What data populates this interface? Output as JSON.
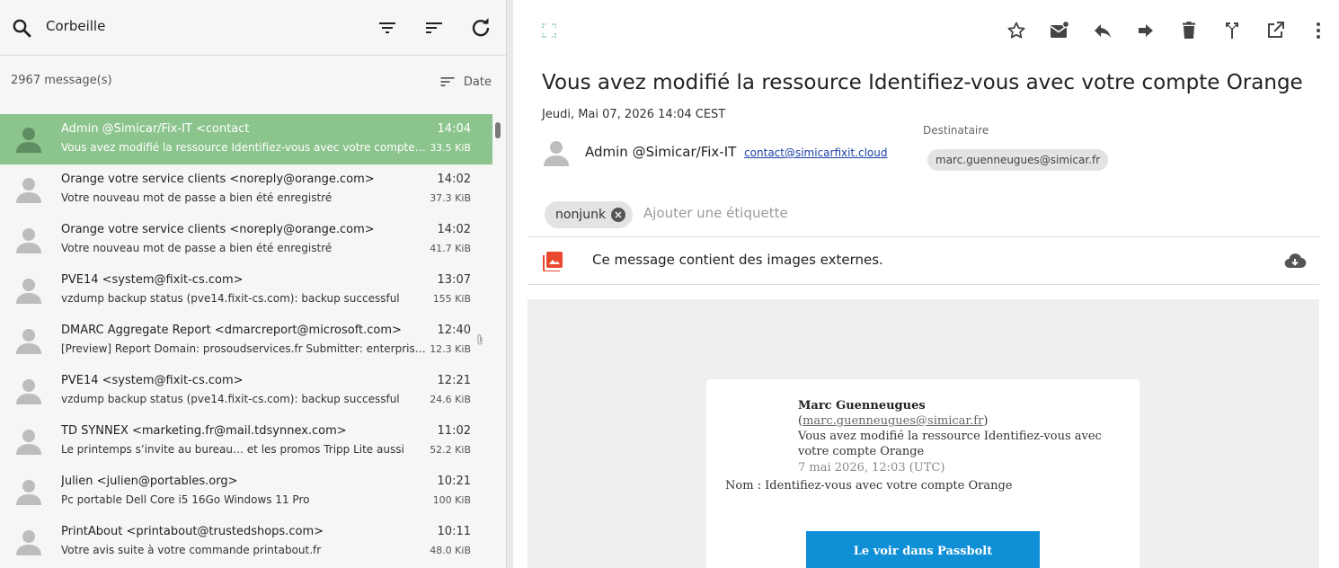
{
  "search": {
    "folder": "Corbeille"
  },
  "list_header": {
    "count": "2967 message(s)",
    "sort_label": "Date"
  },
  "messages": [
    {
      "sender": "Admin @Simicar/Fix-IT <contact",
      "subject": "Vous avez modifié la ressource Identifiez-vous avec votre compte Orange",
      "time": "14:04",
      "size": "33.5 KiB",
      "selected": true
    },
    {
      "sender": "Orange votre service clients <noreply@orange.com>",
      "subject": "Votre nouveau mot de passe a bien été enregistré",
      "time": "14:02",
      "size": "37.3 KiB"
    },
    {
      "sender": "Orange votre service clients <noreply@orange.com>",
      "subject": "Votre nouveau mot de passe a bien été enregistré",
      "time": "14:02",
      "size": "41.7 KiB"
    },
    {
      "sender": "PVE14 <system@fixit-cs.com>",
      "subject": "vzdump backup status (pve14.fixit-cs.com): backup successful",
      "time": "13:07",
      "size": "155 KiB"
    },
    {
      "sender": "DMARC Aggregate Report <dmarcreport@microsoft.com>",
      "subject": "[Preview] Report Domain: prosoudservices.fr Submitter: enterprise.protection.outlook.com",
      "time": "12:40",
      "size": "12.3 KiB",
      "attachment": true
    },
    {
      "sender": "PVE14 <system@fixit-cs.com>",
      "subject": "vzdump backup status (pve14.fixit-cs.com): backup successful",
      "time": "12:21",
      "size": "24.6 KiB"
    },
    {
      "sender": "TD SYNNEX <marketing.fr@mail.tdsynnex.com>",
      "subject": "Le printemps s’invite au bureau… et les promos Tripp Lite aussi",
      "time": "11:02",
      "size": "52.2 KiB"
    },
    {
      "sender": "Julien <julien@portables.org>",
      "subject": "Pc portable Dell Core i5 16Go Windows 11 Pro",
      "time": "10:21",
      "size": "100 KiB"
    },
    {
      "sender": "PrintAbout <printabout@trustedshops.com>",
      "subject": "Votre avis suite à votre commande printabout.fr",
      "time": "10:11",
      "size": "48.0 KiB"
    }
  ],
  "message": {
    "title": "Vous avez modifié la ressource Identifiez-vous avec votre compte Orange",
    "date": "Jeudi, Mai 07, 2026 14:04 CEST",
    "from_name": "Admin @Simicar/Fix-IT",
    "from_email": "contact@simicarfixit.cloud",
    "to_label": "Destinataire",
    "to_address": "marc.guenneugues@simicar.fr",
    "tag": "nonjunk",
    "tag_placeholder": "Ajouter une étiquette",
    "external_images_notice": "Ce message contient des images externes."
  },
  "body": {
    "author_name": "Marc Guenneugues",
    "author_open": " (",
    "author_email": "marc.guenneugues@simicar.fr",
    "author_close": ")",
    "action": "Vous avez modifié la ressource Identifiez-vous avec votre compte Orange",
    "date": "7 mai 2026, 12:03 (UTC)",
    "name_line": "Nom : Identifiez-vous avec votre compte Orange",
    "button": "Le voir dans Passbolt"
  },
  "colors": {
    "selected_row": "#8cc48d",
    "button": "#0e8fd6",
    "image_icon": "#e8492f"
  }
}
